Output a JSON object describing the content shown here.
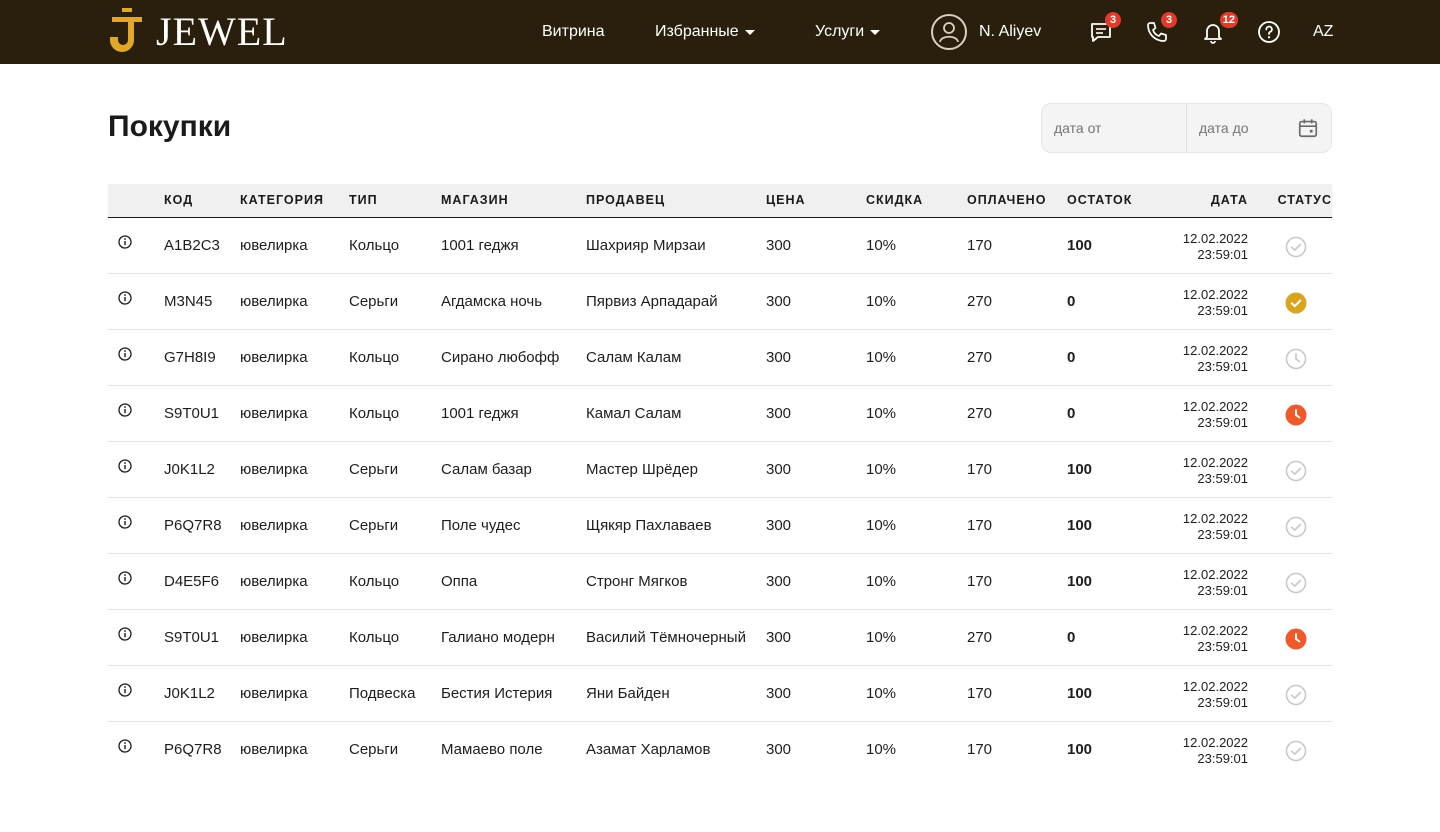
{
  "brand": {
    "logo_text": "JEWEL",
    "accent": "#e0a825",
    "header_bg": "#2a1f0c"
  },
  "nav": {
    "vitrina": "Витрина",
    "favorites": "Избранные",
    "services": "Услуги",
    "user_name": "N. Aliyev",
    "messages_count": "3",
    "calls_count": "3",
    "notifications_count": "12",
    "language": "AZ"
  },
  "page": {
    "title": "Покупки",
    "date_from_placeholder": "дата от",
    "date_to_placeholder": "дата до"
  },
  "table": {
    "headers": {
      "code": "КОД",
      "category": "КАТЕГОРИЯ",
      "type": "ТИП",
      "shop": "МАГАЗИН",
      "seller": "ПРОДАВЕЦ",
      "price": "ЦЕНА",
      "discount": "СКИДКА",
      "paid": "ОПЛАЧЕНО",
      "rest": "ОСТАТОК",
      "date": "ДАТА",
      "status": "СТАТУС"
    },
    "status_colors": {
      "done": "#c8c8c8",
      "paid": "#d9a520",
      "pending": "#c8c8c8",
      "overdue": "#f0592a"
    },
    "rows": [
      {
        "code": "A1B2C3",
        "category": "ювелирка",
        "type": "Кольцо",
        "shop": "1001 геджя",
        "seller": "Шахрияр Мирзаи",
        "price": "300",
        "discount": "10%",
        "paid": "170",
        "rest": "100",
        "date": "12.02.2022",
        "time": "23:59:01",
        "status": "done"
      },
      {
        "code": "M3N45",
        "category": "ювелирка",
        "type": "Серьги",
        "shop": "Агдамска ночь",
        "seller": "Пярвиз Арпадарай",
        "price": "300",
        "discount": "10%",
        "paid": "270",
        "rest": "0",
        "date": "12.02.2022",
        "time": "23:59:01",
        "status": "paid"
      },
      {
        "code": "G7H8I9",
        "category": "ювелирка",
        "type": "Кольцо",
        "shop": "Сирано любофф",
        "seller": "Салам Калам",
        "price": "300",
        "discount": "10%",
        "paid": "270",
        "rest": "0",
        "date": "12.02.2022",
        "time": "23:59:01",
        "status": "pending"
      },
      {
        "code": "S9T0U1",
        "category": "ювелирка",
        "type": "Кольцо",
        "shop": "1001 геджя",
        "seller": "Камал Салам",
        "price": "300",
        "discount": "10%",
        "paid": "270",
        "rest": "0",
        "date": "12.02.2022",
        "time": "23:59:01",
        "status": "overdue"
      },
      {
        "code": "J0K1L2",
        "category": "ювелирка",
        "type": "Серьги",
        "shop": "Салам базар",
        "seller": "Мастер Шрёдер",
        "price": "300",
        "discount": "10%",
        "paid": "170",
        "rest": "100",
        "date": "12.02.2022",
        "time": "23:59:01",
        "status": "done"
      },
      {
        "code": "P6Q7R8",
        "category": "ювелирка",
        "type": "Серьги",
        "shop": "Поле чудес",
        "seller": "Щякяр Пахлаваев",
        "price": "300",
        "discount": "10%",
        "paid": "170",
        "rest": "100",
        "date": "12.02.2022",
        "time": "23:59:01",
        "status": "done"
      },
      {
        "code": "D4E5F6",
        "category": "ювелирка",
        "type": "Кольцо",
        "shop": "Оппа",
        "seller": "Стронг Мягков",
        "price": "300",
        "discount": "10%",
        "paid": "170",
        "rest": "100",
        "date": "12.02.2022",
        "time": "23:59:01",
        "status": "done"
      },
      {
        "code": "S9T0U1",
        "category": "ювелирка",
        "type": "Кольцо",
        "shop": "Галиано модерн",
        "seller": "Василий Тёмночерный",
        "price": "300",
        "discount": "10%",
        "paid": "270",
        "rest": "0",
        "date": "12.02.2022",
        "time": "23:59:01",
        "status": "overdue"
      },
      {
        "code": "J0K1L2",
        "category": "ювелирка",
        "type": "Подвеска",
        "shop": "Бестия Истерия",
        "seller": "Яни Байден",
        "price": "300",
        "discount": "10%",
        "paid": "170",
        "rest": "100",
        "date": "12.02.2022",
        "time": "23:59:01",
        "status": "done"
      },
      {
        "code": "P6Q7R8",
        "category": "ювелирка",
        "type": "Серьги",
        "shop": "Мамаево поле",
        "seller": "Азамат Харламов",
        "price": "300",
        "discount": "10%",
        "paid": "170",
        "rest": "100",
        "date": "12.02.2022",
        "time": "23:59:01",
        "status": "done"
      }
    ]
  }
}
